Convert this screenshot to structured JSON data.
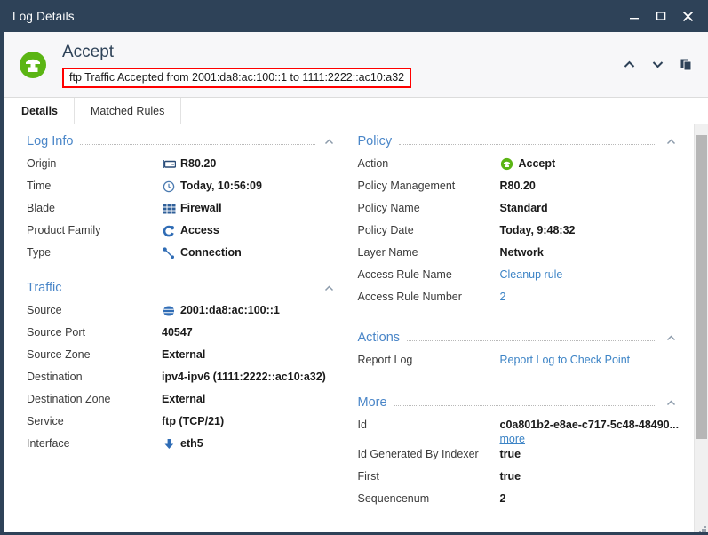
{
  "window": {
    "title": "Log Details",
    "minimize_label": "Minimize",
    "maximize_label": "Maximize",
    "close_label": "Close"
  },
  "header": {
    "icon": "accept-shield-icon",
    "title": "Accept",
    "subtitle": "ftp Traffic Accepted from 2001:da8:ac:100::1 to 1111:2222::ac10:a32",
    "highlight_color": "#ff0000",
    "accent_color": "#5bb514",
    "actions": [
      {
        "name": "previous-log-button",
        "icon": "chevron-up-icon"
      },
      {
        "name": "next-log-button",
        "icon": "chevron-down-icon"
      },
      {
        "name": "copy-button",
        "icon": "copy-icon"
      }
    ]
  },
  "tabs": [
    {
      "label": "Details",
      "active": true
    },
    {
      "label": "Matched Rules",
      "active": false
    }
  ],
  "sections": {
    "log_info": {
      "title": "Log Info",
      "collapse_icon": "chevron-up-icon",
      "rows": [
        {
          "label": "Origin",
          "value": "R80.20",
          "icon": "gateway-icon",
          "style": "bold"
        },
        {
          "label": "Time",
          "value": "Today, 10:56:09",
          "icon": "clock-icon",
          "style": "bold"
        },
        {
          "label": "Blade",
          "value": "Firewall",
          "icon": "firewall-icon",
          "style": "bold"
        },
        {
          "label": "Product Family",
          "value": "Access",
          "icon": "access-icon",
          "style": "bold"
        },
        {
          "label": "Type",
          "value": "Connection",
          "icon": "connection-icon",
          "style": "bold"
        }
      ]
    },
    "traffic": {
      "title": "Traffic",
      "collapse_icon": "chevron-up-icon",
      "rows": [
        {
          "label": "Source",
          "value": "2001:da8:ac:100::1",
          "icon": "globe-icon",
          "style": "bold"
        },
        {
          "label": "Source Port",
          "value": "40547",
          "icon": "",
          "style": "bold"
        },
        {
          "label": "Source Zone",
          "value": "External",
          "icon": "",
          "style": "bold"
        },
        {
          "label": "Destination",
          "value": "ipv4-ipv6 (1111:2222::ac10:a32)",
          "icon": "",
          "style": "bold"
        },
        {
          "label": "Destination Zone",
          "value": "External",
          "icon": "",
          "style": "bold"
        },
        {
          "label": "Service",
          "value": "ftp (TCP/21)",
          "icon": "",
          "style": "bold"
        },
        {
          "label": "Interface",
          "value": "eth5",
          "icon": "inbound-arrow-icon",
          "style": "bold"
        }
      ]
    },
    "policy": {
      "title": "Policy",
      "collapse_icon": "chevron-up-icon",
      "rows": [
        {
          "label": "Action",
          "value": "Accept",
          "icon": "accept-shield-icon",
          "style": "bold"
        },
        {
          "label": "Policy Management",
          "value": "R80.20",
          "icon": "",
          "style": "bold"
        },
        {
          "label": "Policy Name",
          "value": "Standard",
          "icon": "",
          "style": "bold"
        },
        {
          "label": "Policy Date",
          "value": "Today, 9:48:32",
          "icon": "",
          "style": "bold"
        },
        {
          "label": "Layer Name",
          "value": "Network",
          "icon": "",
          "style": "bold"
        },
        {
          "label": "Access Rule Name",
          "value": "Cleanup rule",
          "icon": "",
          "style": "link"
        },
        {
          "label": "Access Rule Number",
          "value": "2",
          "icon": "",
          "style": "link"
        }
      ]
    },
    "actions": {
      "title": "Actions",
      "collapse_icon": "chevron-up-icon",
      "rows": [
        {
          "label": "Report Log",
          "value": "Report Log to Check Point",
          "icon": "",
          "style": "link"
        }
      ]
    },
    "more": {
      "title": "More",
      "collapse_icon": "chevron-up-icon",
      "id_label": "Id",
      "id_value": "c0a801b2-e8ae-c717-5c48-48490...",
      "id_more_link": "more",
      "rows": [
        {
          "label": "Id Generated By Indexer",
          "value": "true",
          "icon": "",
          "style": "bold"
        },
        {
          "label": "First",
          "value": "true",
          "icon": "",
          "style": "bold"
        },
        {
          "label": "Sequencenum",
          "value": "2",
          "icon": "",
          "style": "bold"
        }
      ]
    }
  }
}
